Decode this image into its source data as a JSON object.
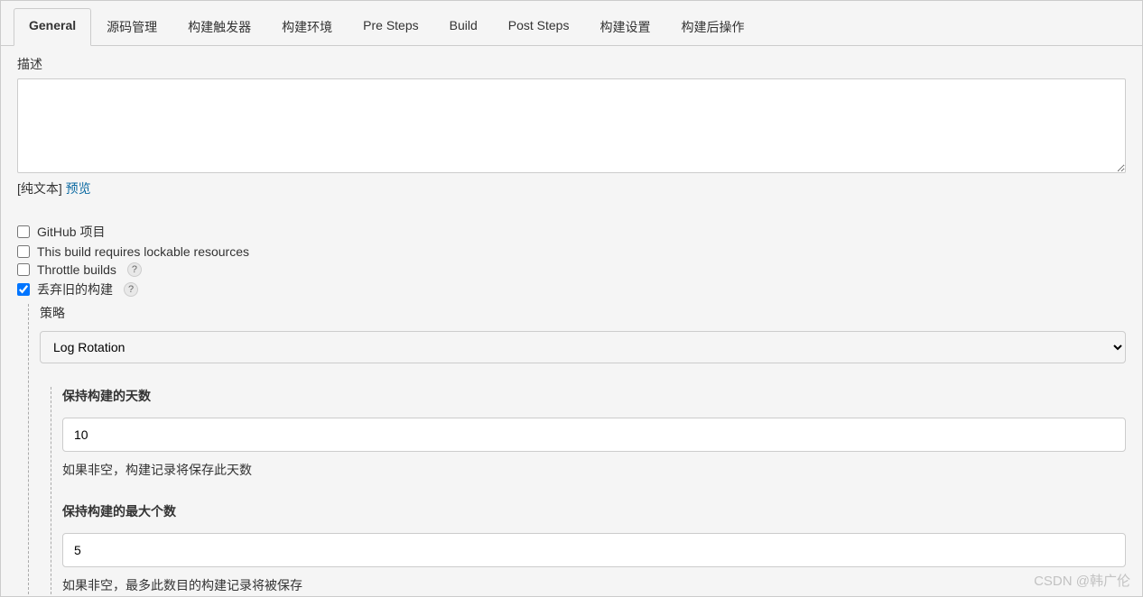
{
  "tabs": [
    {
      "label": "General",
      "active": true
    },
    {
      "label": "源码管理",
      "active": false
    },
    {
      "label": "构建触发器",
      "active": false
    },
    {
      "label": "构建环境",
      "active": false
    },
    {
      "label": "Pre Steps",
      "active": false
    },
    {
      "label": "Build",
      "active": false
    },
    {
      "label": "Post Steps",
      "active": false
    },
    {
      "label": "构建设置",
      "active": false
    },
    {
      "label": "构建后操作",
      "active": false
    }
  ],
  "description": {
    "label": "描述",
    "value": "",
    "plain_text_prefix": "[纯文本] ",
    "preview_link": "预览"
  },
  "checkboxes": {
    "github_project": "GitHub 项目",
    "lockable_resources": "This build requires lockable resources",
    "throttle_builds": "Throttle builds",
    "discard_old_builds": "丢弃旧的构建"
  },
  "strategy": {
    "label": "策略",
    "selected": "Log Rotation"
  },
  "days_to_keep": {
    "title": "保持构建的天数",
    "value": "10",
    "hint": "如果非空，构建记录将保存此天数"
  },
  "max_to_keep": {
    "title": "保持构建的最大个数",
    "value": "5",
    "hint": "如果非空，最多此数目的构建记录将被保存"
  },
  "help_icon": "?",
  "watermark": "CSDN @韩广伦"
}
